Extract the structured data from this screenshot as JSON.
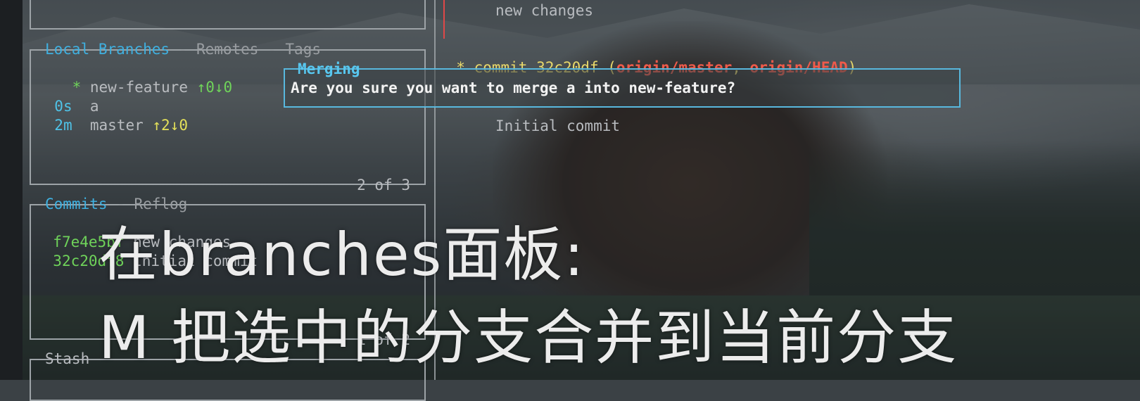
{
  "branches_panel": {
    "tabs": [
      "Local Branches",
      "Remotes",
      "Tags"
    ],
    "separator": " - ",
    "footer": "2 of 3",
    "items": [
      {
        "prefix": "  *",
        "name": "new-feature",
        "status": "↑0↓0",
        "status_color": "#6fd35a"
      },
      {
        "prefix": "0s ",
        "name": "a",
        "status": "",
        "status_color": ""
      },
      {
        "prefix": "2m ",
        "name": "master",
        "status": "↑2↓0",
        "status_color": "#e3e05a"
      }
    ]
  },
  "commits_panel": {
    "tabs": [
      "Commits",
      "Reflog"
    ],
    "separator": " - ",
    "footer": "1 of 2",
    "items": [
      {
        "sha": "f7e4e5bf",
        "message": "new changes"
      },
      {
        "sha": "32c20df8",
        "message": "Initial commit"
      }
    ]
  },
  "stash_panel": {
    "title": "Stash"
  },
  "main_view": {
    "top_line": "new changes",
    "commit_prefix": "* commit 32c20df (",
    "ref1": "origin/master",
    "ref_sep": ", ",
    "ref2": "origin/HEAD",
    "commit_suffix": ")",
    "body": "Initial commit"
  },
  "dialog": {
    "title": "Merging",
    "message": "Are you sure you want to merge a into new-feature?"
  },
  "subtitles": {
    "line1": "在branches面板:",
    "line2": "M 把选中的分支合并到当前分支"
  },
  "colors": {
    "active_tab": "#3fb0e0",
    "sha": "#6fd35a",
    "dialog_border": "#58b8de",
    "ref": "#f05a4a"
  }
}
